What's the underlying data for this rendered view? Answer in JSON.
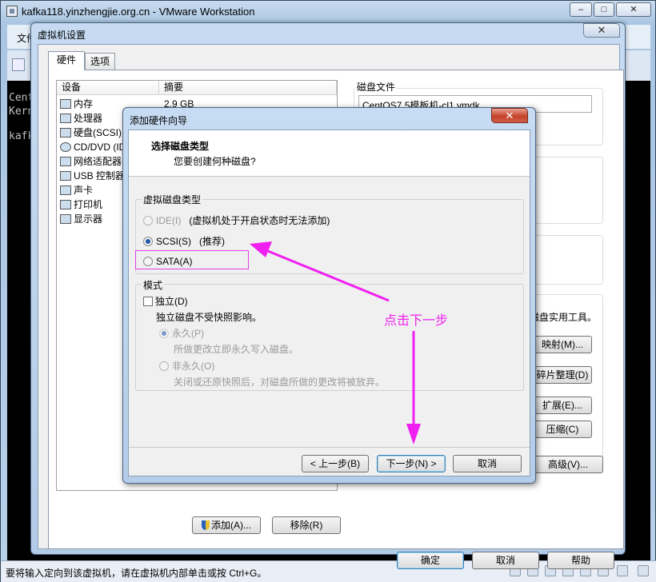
{
  "window": {
    "title": "kafka118.yinzhengjie.org.cn - VMware Workstation",
    "menu_first": "文件"
  },
  "console": {
    "lines": [
      "CentOS",
      "Kernel",
      "kafka"
    ]
  },
  "status": {
    "message": "要将输入定向到该虚拟机，请在虚拟机内部单击或按 Ctrl+G。"
  },
  "settings": {
    "title": "虚拟机设置",
    "tabs": [
      "硬件",
      "选项"
    ],
    "table_headers": {
      "device": "设备",
      "summary": "摘要"
    },
    "devices": [
      {
        "name": "内存",
        "summary": "2.9 GB",
        "icon": "memory-icon"
      },
      {
        "name": "处理器",
        "summary": "",
        "icon": "cpu-icon"
      },
      {
        "name": "硬盘(SCSI)",
        "summary": "",
        "icon": "hard-disk-icon"
      },
      {
        "name": "CD/DVD (IDE)",
        "summary": "",
        "icon": "cd-dvd-icon"
      },
      {
        "name": "网络适配器",
        "summary": "",
        "icon": "network-icon"
      },
      {
        "name": "USB 控制器",
        "summary": "",
        "icon": "usb-icon"
      },
      {
        "name": "声卡",
        "summary": "",
        "icon": "sound-icon"
      },
      {
        "name": "打印机",
        "summary": "",
        "icon": "printer-icon"
      },
      {
        "name": "显示器",
        "summary": "",
        "icon": "display-icon"
      }
    ],
    "disk_file_label": "磁盘文件",
    "disk_file_value": "CentOS7.5模板机-cl1.vmdk",
    "utility_text": "磁盘实用工具。",
    "utility_buttons": [
      "映射(M)...",
      "碎片整理(D)",
      "扩展(E)...",
      "压缩(C)"
    ],
    "advanced_button": "高级(V)...",
    "add_button": "添加(A)...",
    "remove_button": "移除(R)",
    "ok_button": "确定",
    "cancel_button": "取消",
    "help_button": "帮助"
  },
  "wizard": {
    "title": "添加硬件向导",
    "heading": "选择磁盘类型",
    "subheading": "您要创建何种磁盘?",
    "disk_type_group": "虚拟磁盘类型",
    "ide_label": "IDE(I)",
    "ide_note": "(虚拟机处于开启状态时无法添加)",
    "scsi_label": "SCSI(S)",
    "scsi_note": "(推荐)",
    "sata_label": "SATA(A)",
    "mode_group": "模式",
    "independent_label": "独立(D)",
    "independent_desc": "独立磁盘不受快照影响。",
    "persistent_label": "永久(P)",
    "persistent_desc": "所做更改立即永久写入磁盘。",
    "nonpersistent_label": "非永久(O)",
    "nonpersistent_desc": "关闭或还原快照后，对磁盘所做的更改将被放弃。",
    "back_button": "< 上一步(B)",
    "next_button": "下一步(N) >",
    "cancel_button": "取消",
    "selected": "SCSI"
  },
  "annotation": {
    "text": "点击下一步",
    "color": "#f020f0"
  }
}
